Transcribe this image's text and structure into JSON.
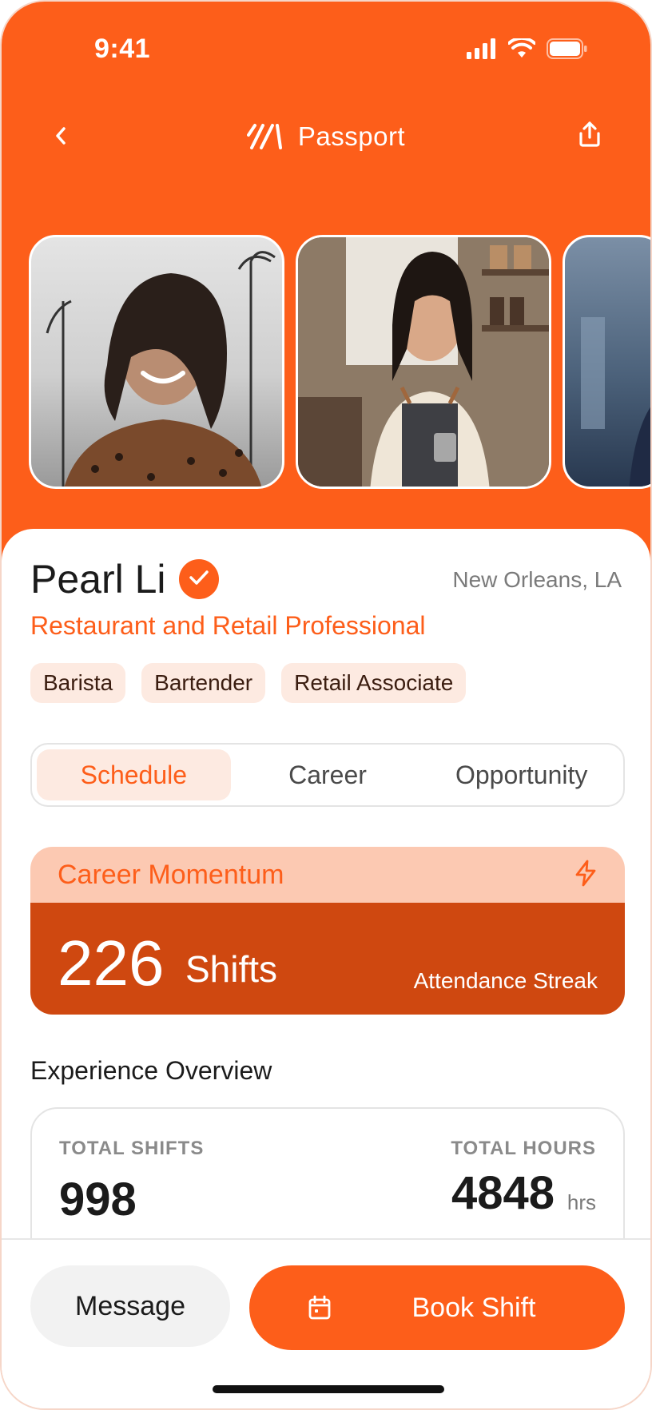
{
  "status_bar": {
    "time": "9:41"
  },
  "nav": {
    "title": "Passport"
  },
  "profile": {
    "name": "Pearl Li",
    "location": "New Orleans, LA",
    "role": "Restaurant and Retail Professional",
    "tags": [
      "Barista",
      "Bartender",
      "Retail Associate"
    ]
  },
  "tabs": [
    {
      "label": "Schedule",
      "active": true
    },
    {
      "label": "Career",
      "active": false
    },
    {
      "label": "Opportunity",
      "active": false
    }
  ],
  "momentum": {
    "title": "Career Momentum",
    "number": "226",
    "unit": "Shifts",
    "subtitle": "Attendance Streak"
  },
  "overview": {
    "title": "Experience Overview",
    "total_shifts_label": "TOTAL SHIFTS",
    "total_shifts_value": "998",
    "total_hours_label": "TOTAL HOURS",
    "total_hours_value": "4848",
    "total_hours_unit": "hrs"
  },
  "actions": {
    "message_label": "Message",
    "book_label": "Book Shift"
  },
  "colors": {
    "accent": "#fd5e1a",
    "accent_dark": "#cf4810",
    "accent_light": "#fdeae1"
  }
}
